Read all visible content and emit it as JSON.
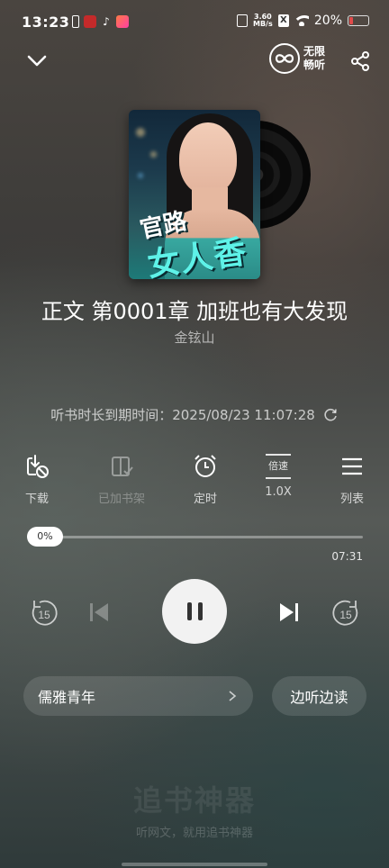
{
  "status_bar": {
    "time": "13:23",
    "net_speed_value": "3.60",
    "net_speed_unit": "MB/s",
    "sim_label": "X",
    "battery": "20%"
  },
  "header": {
    "unlimited_line1": "无限",
    "unlimited_line2": "畅听"
  },
  "book": {
    "cover_title_line1": "官路",
    "cover_title_line2": "女人香"
  },
  "track": {
    "title": "正文 第0001章 加班也有大发现",
    "author": "金铉山"
  },
  "membership": {
    "expire_text": "听书时长到期时间：2025/08/23 11:07:28"
  },
  "actions": {
    "download": "下载",
    "added_shelf": "已加书架",
    "timer": "定时",
    "speed_icon": "倍速",
    "speed": "1.0X",
    "playlist": "列表"
  },
  "progress": {
    "percent_label": "0%",
    "value": 0,
    "duration": "07:31"
  },
  "controls": {
    "rewind_seconds": "15",
    "forward_seconds": "15"
  },
  "voice": {
    "name": "儒雅青年",
    "read_along": "边听边读"
  },
  "watermark": {
    "logo": "追书神器",
    "slogan": "听网文，就用追书神器"
  },
  "colors": {
    "accent_cyan": "#5ef2e8",
    "battery_low": "#e14b4b"
  }
}
